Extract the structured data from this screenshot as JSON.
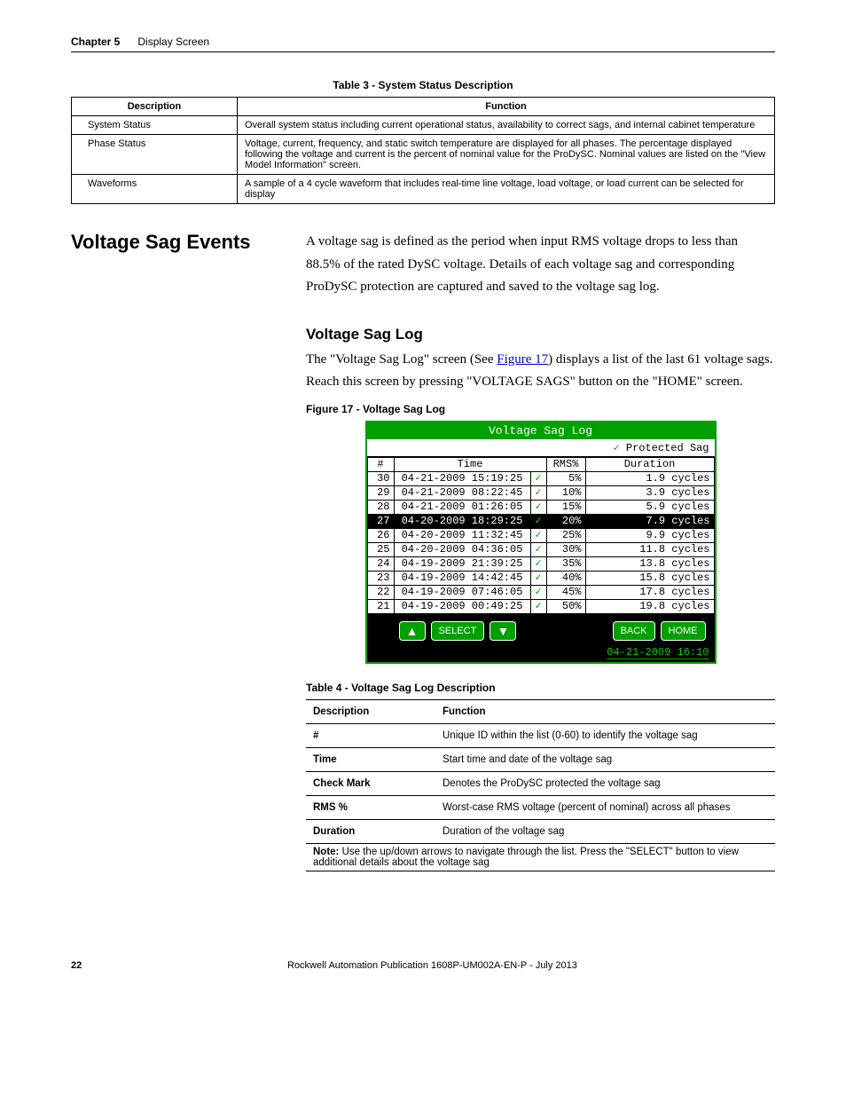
{
  "header": {
    "chapter": "Chapter 5",
    "title": "Display Screen"
  },
  "table3": {
    "caption": "Table 3 - System Status Description",
    "head_desc": "Description",
    "head_func": "Function",
    "rows": [
      {
        "desc": "System Status",
        "func": "Overall system status including current operational status, availability to correct sags, and internal cabinet temperature"
      },
      {
        "desc": "Phase Status",
        "func": "Voltage, current, frequency, and static switch temperature are displayed for all phases. The percentage displayed following the voltage and current is the percent of nominal value for the ProDySC. Nominal values are listed on the \"View Model Information\" screen."
      },
      {
        "desc": "Waveforms",
        "func": "A sample of a 4 cycle waveform that includes real-time line voltage, load voltage, or load current can be selected for display"
      }
    ]
  },
  "section": {
    "title": "Voltage Sag Events",
    "para1": "A voltage sag is defined as the period when input RMS voltage drops to less than 88.5% of the rated DySC voltage. Details of each voltage sag and corresponding ProDySC protection are captured and saved to the voltage sag log.",
    "subtitle": "Voltage Sag Log",
    "para2a": "The \"Voltage Sag Log\" screen (See ",
    "figlink": "Figure 17",
    "para2b": ") displays a list of the last 61 voltage sags. Reach this screen by pressing \"VOLTAGE SAGS\" button on the \"HOME\" screen.",
    "fig_caption": "Figure 17 - Voltage Sag Log"
  },
  "device": {
    "title": "Voltage Sag Log",
    "legend_check": "✓",
    "legend_text": "Protected Sag",
    "head_num": "#",
    "head_time": "Time",
    "head_rms": "RMS%",
    "head_dur": "Duration",
    "rows": [
      {
        "n": "30",
        "time": "04-21-2009 15:19:25",
        "chk": "✓",
        "rms": "5%",
        "dur": "1.9 cycles",
        "sel": false
      },
      {
        "n": "29",
        "time": "04-21-2009 08:22:45",
        "chk": "✓",
        "rms": "10%",
        "dur": "3.9 cycles",
        "sel": false
      },
      {
        "n": "28",
        "time": "04-21-2009 01:26:05",
        "chk": "✓",
        "rms": "15%",
        "dur": "5.9 cycles",
        "sel": false
      },
      {
        "n": "27",
        "time": "04-20-2009 18:29:25",
        "chk": "✓",
        "rms": "20%",
        "dur": "7.9 cycles",
        "sel": true
      },
      {
        "n": "26",
        "time": "04-20-2009 11:32:45",
        "chk": "✓",
        "rms": "25%",
        "dur": "9.9 cycles",
        "sel": false
      },
      {
        "n": "25",
        "time": "04-20-2009 04:36:05",
        "chk": "✓",
        "rms": "30%",
        "dur": "11.8 cycles",
        "sel": false
      },
      {
        "n": "24",
        "time": "04-19-2009 21:39:25",
        "chk": "✓",
        "rms": "35%",
        "dur": "13.8 cycles",
        "sel": false
      },
      {
        "n": "23",
        "time": "04-19-2009 14:42:45",
        "chk": "✓",
        "rms": "40%",
        "dur": "15.8 cycles",
        "sel": false
      },
      {
        "n": "22",
        "time": "04-19-2009 07:46:05",
        "chk": "✓",
        "rms": "45%",
        "dur": "17.8 cycles",
        "sel": false
      },
      {
        "n": "21",
        "time": "04-19-2009 00:49:25",
        "chk": "✓",
        "rms": "50%",
        "dur": "19.8 cycles",
        "sel": false
      }
    ],
    "btn_up": "▲",
    "btn_select": "SELECT",
    "btn_down": "▼",
    "btn_back": "BACK",
    "btn_home": "HOME",
    "footer_time": "04-21-2009 16:10"
  },
  "table4": {
    "caption": "Table 4 - Voltage Sag Log Description",
    "head_desc": "Description",
    "head_func": "Function",
    "rows": [
      {
        "desc": "#",
        "func": "Unique ID within the list (0-60) to identify the voltage sag"
      },
      {
        "desc": "Time",
        "func": "Start time and date of the voltage sag"
      },
      {
        "desc": "Check Mark",
        "func": "Denotes the ProDySC protected the voltage sag"
      },
      {
        "desc": "RMS %",
        "func": "Worst-case RMS voltage (percent of nominal) across all phases"
      },
      {
        "desc": "Duration",
        "func": "Duration of the voltage sag"
      }
    ],
    "note_label": "Note:",
    "note_text": " Use the up/down arrows to navigate through the list. Press the \"SELECT\" button to view additional details about the voltage sag"
  },
  "footer": {
    "page": "22",
    "pub": "Rockwell Automation Publication 1608P-UM002A-EN-P - July 2013"
  }
}
